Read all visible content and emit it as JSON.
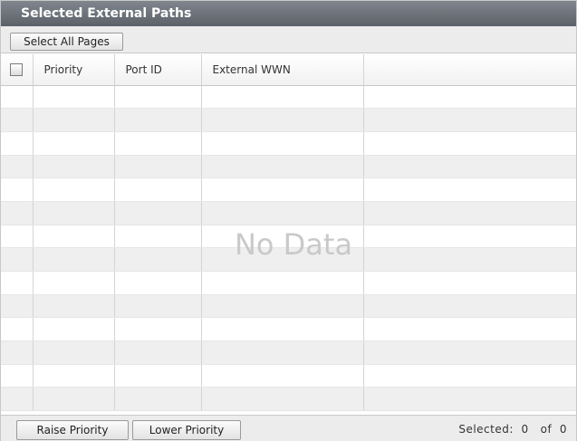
{
  "panel": {
    "title": "Selected External Paths"
  },
  "toolbar": {
    "select_all_label": "Select All Pages"
  },
  "table": {
    "columns": [
      "Priority",
      "Port ID",
      "External WWN",
      ""
    ],
    "rows": [],
    "empty_message": "No Data"
  },
  "footer": {
    "raise_label": "Raise Priority",
    "lower_label": "Lower Priority",
    "selected_label": "Selected:",
    "selected_count": "0",
    "of_label": "of",
    "total_count": "0"
  }
}
